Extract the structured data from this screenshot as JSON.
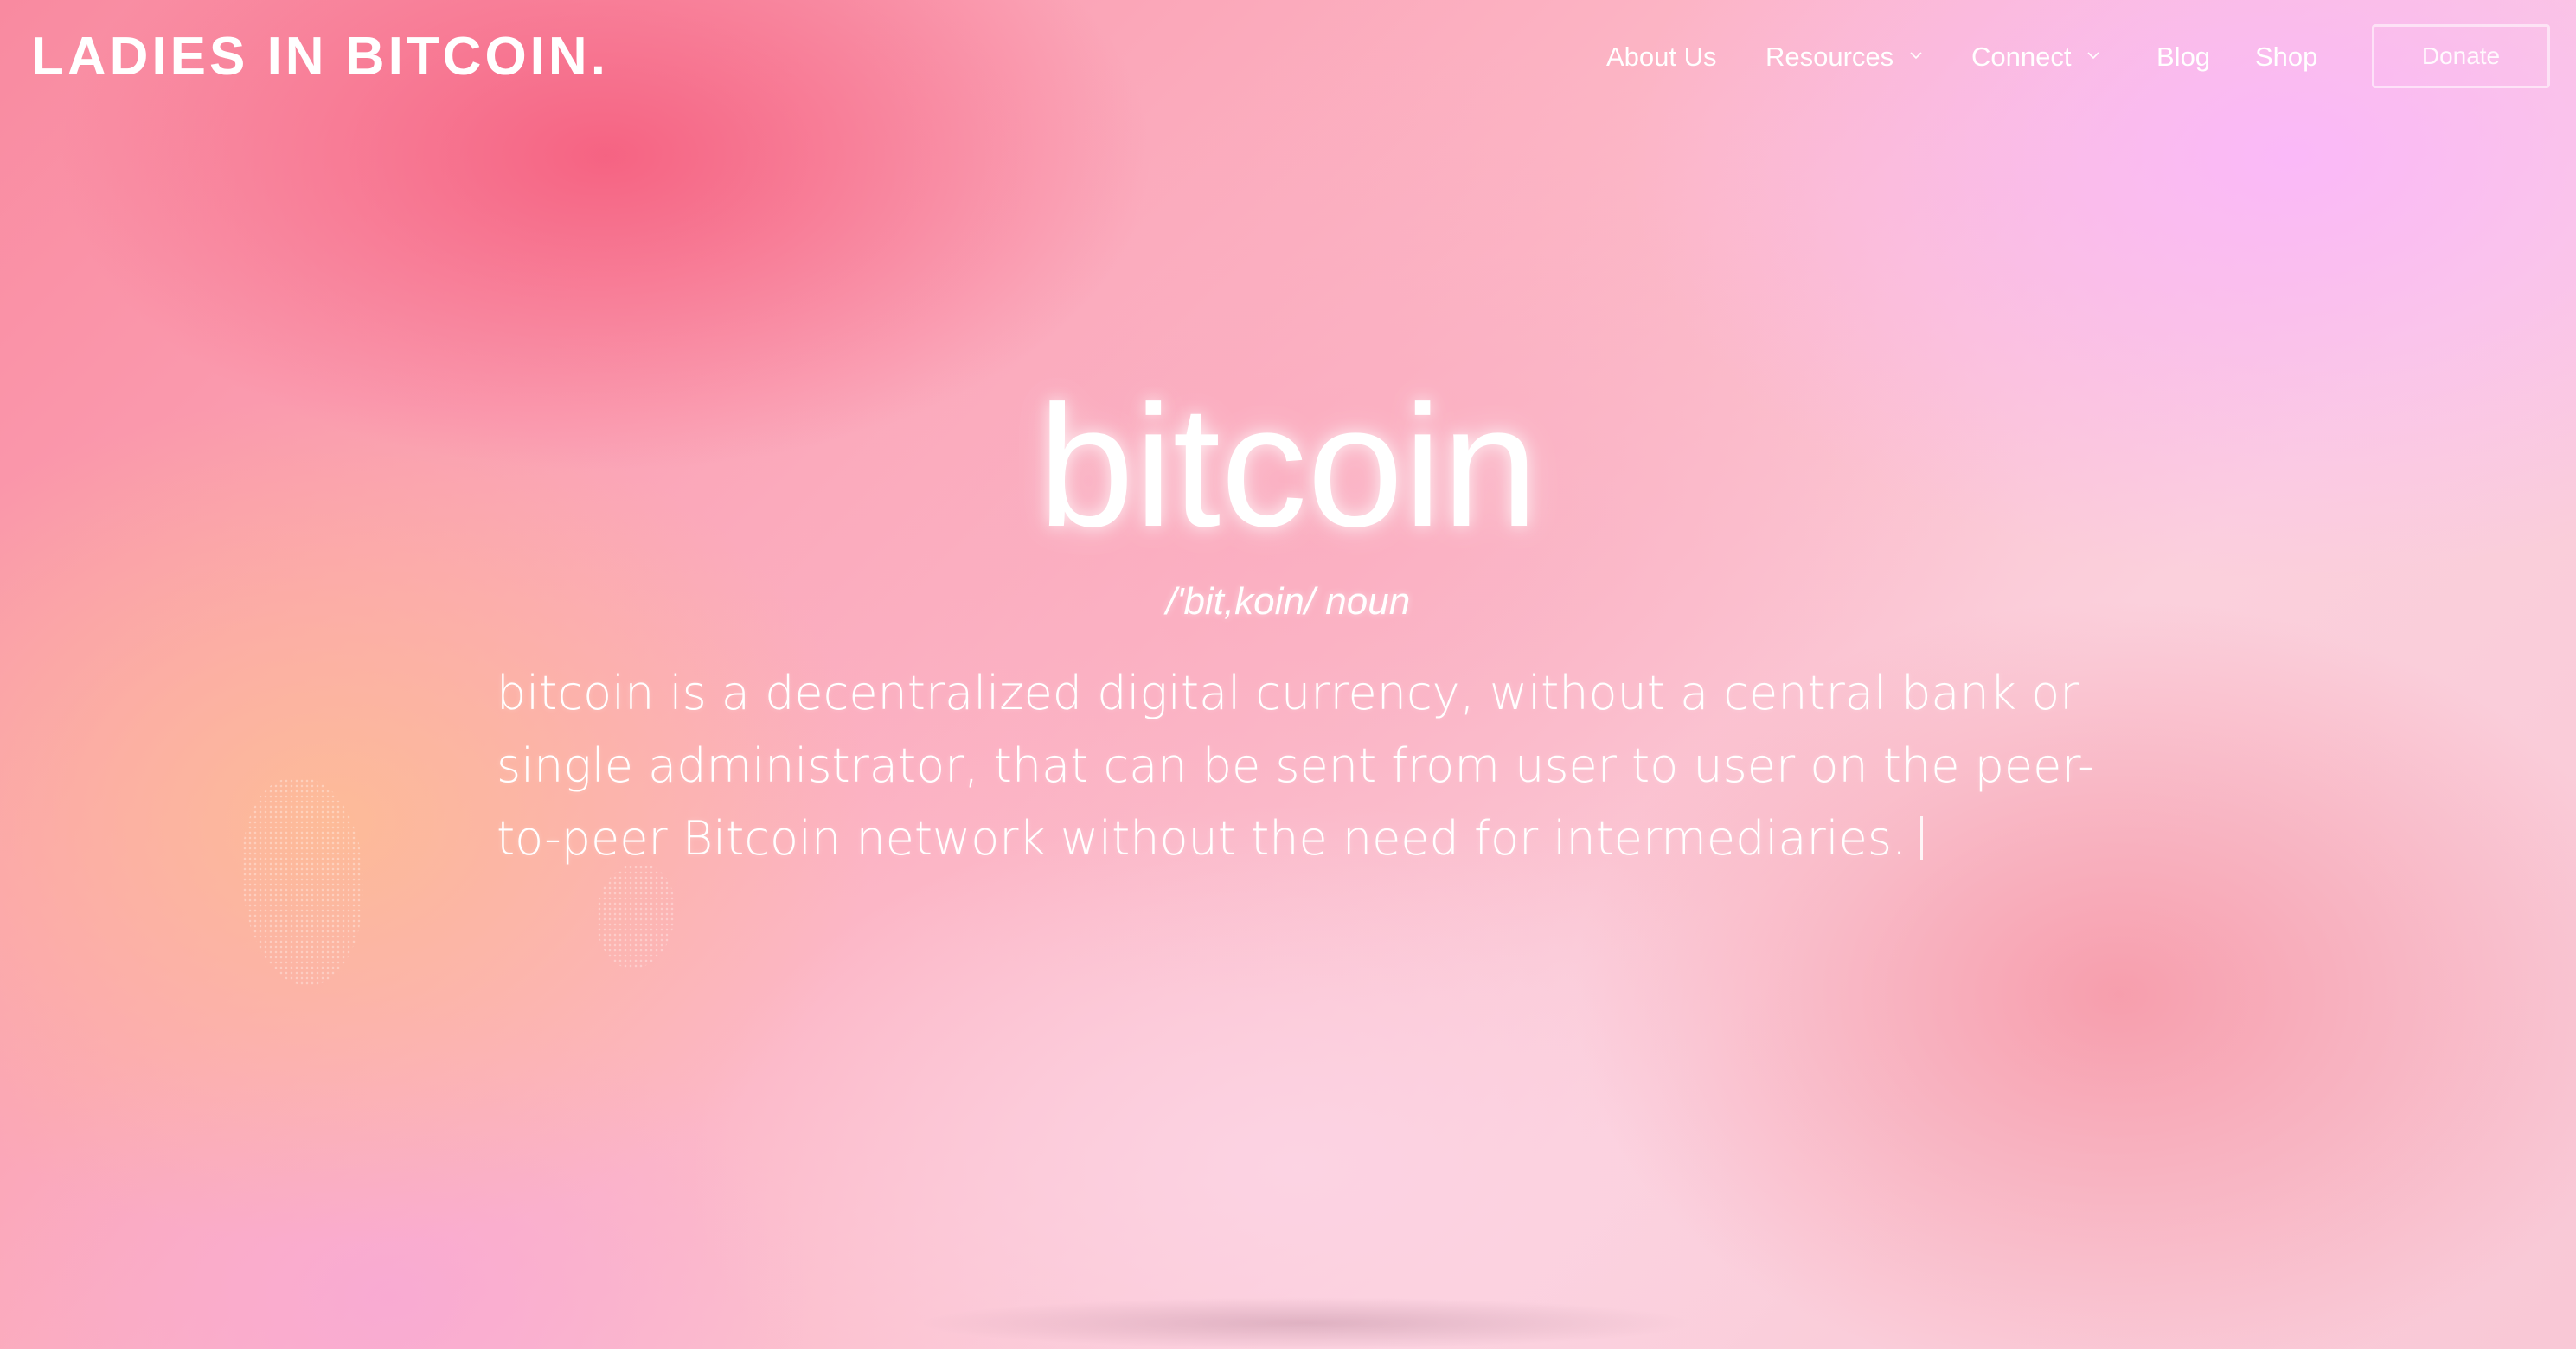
{
  "header": {
    "logo": "LADIES IN BITCOIN",
    "logo_dot": ".",
    "nav": {
      "about": "About Us",
      "resources": "Resources",
      "connect": "Connect",
      "blog": "Blog",
      "shop": "Shop"
    },
    "donate_label": "Donate"
  },
  "hero": {
    "title": "bitcoin",
    "pronunciation": "/'bit,koin/ noun",
    "definition": "bitcoin is a decentralized digital currency, without a central bank or single administrator, that can be sent from user to user on the peer-to-peer Bitcoin network without the need for intermediaries."
  },
  "icons": {
    "resources_dropdown": "chevron-down-icon",
    "connect_dropdown": "chevron-down-icon"
  }
}
